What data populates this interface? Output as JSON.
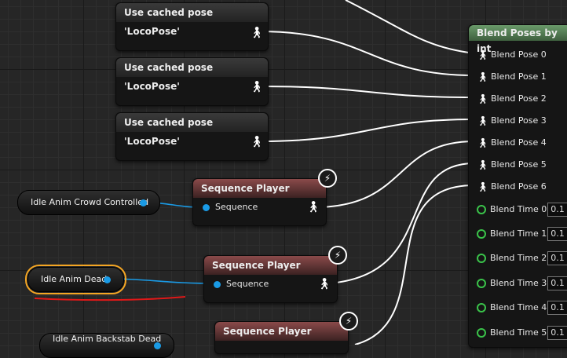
{
  "cached_pose_nodes": [
    {
      "title": "Use cached pose 'LocoPose'"
    },
    {
      "title": "Use cached pose 'LocoPose'"
    },
    {
      "title": "Use cached pose 'LocoPose'"
    }
  ],
  "sequence_players": [
    {
      "title": "Sequence Player",
      "pin": "Sequence"
    },
    {
      "title": "Sequence Player",
      "pin": "Sequence"
    },
    {
      "title": "Sequence Player"
    }
  ],
  "variables": [
    {
      "label": "Idle Anim Crowd Controlled"
    },
    {
      "label": "Idle Anim Dead"
    },
    {
      "label": "Idle Anim Backstab Dead"
    }
  ],
  "blend_node": {
    "title": "Blend Poses by int",
    "poses": [
      "Blend Pose 0",
      "Blend Pose 1",
      "Blend Pose 2",
      "Blend Pose 3",
      "Blend Pose 4",
      "Blend Pose 5",
      "Blend Pose 6"
    ],
    "times": [
      {
        "label": "Blend Time 0",
        "value": "0.1"
      },
      {
        "label": "Blend Time 1",
        "value": "0.1"
      },
      {
        "label": "Blend Time 2",
        "value": "0.1"
      },
      {
        "label": "Blend Time 3",
        "value": "0.1"
      },
      {
        "label": "Blend Time 4",
        "value": "0.1"
      },
      {
        "label": "Blend Time 5",
        "value": "0.1"
      }
    ]
  },
  "icons": {
    "pose": "person-pose-icon",
    "exec": "lightning-bolt-icon",
    "pin": "blue-pin-dot"
  },
  "colors": {
    "wire_pose": "#ffffff",
    "wire_var": "#1a9be6",
    "selected_outline": "#f5a623",
    "annotation": "#e01818",
    "blend_time_pin": "#3ac34a"
  }
}
